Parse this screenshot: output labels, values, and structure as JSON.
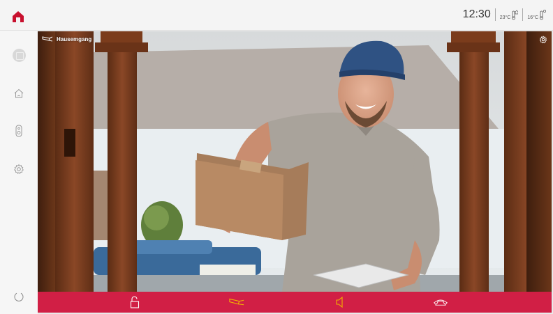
{
  "header": {
    "time": "12:30",
    "indoor_temp": "23°C",
    "outdoor_temp": "16°C"
  },
  "sidebar": {
    "items": [
      {
        "name": "profile",
        "icon": "user-avatar-icon"
      },
      {
        "name": "home",
        "icon": "house-icon"
      },
      {
        "name": "intercom",
        "icon": "doorbell-icon"
      },
      {
        "name": "settings",
        "icon": "gear-icon"
      },
      {
        "name": "power",
        "icon": "power-icon"
      }
    ]
  },
  "video": {
    "camera_name": "Hausemgang",
    "camera_icon": "camera-icon",
    "settings_icon": "gear-icon"
  },
  "controls": {
    "items": [
      {
        "name": "door-open",
        "icon": "unlock-icon"
      },
      {
        "name": "camera",
        "icon": "camera-icon",
        "active": true
      },
      {
        "name": "speaker",
        "icon": "speaker-icon"
      },
      {
        "name": "hang-up",
        "icon": "phone-hangup-icon"
      }
    ]
  },
  "colors": {
    "accent": "#d11f45",
    "active_icon": "#f1b300",
    "icon_stroke": "#ffffff"
  }
}
